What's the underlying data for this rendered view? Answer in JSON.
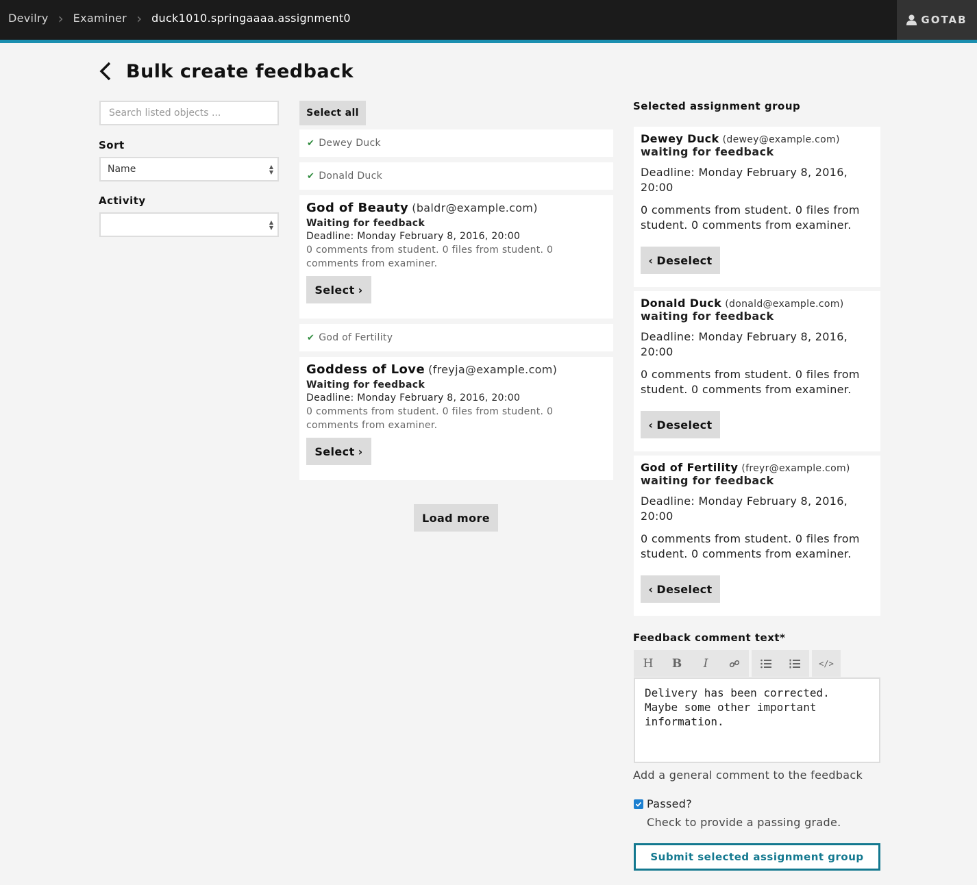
{
  "nav": {
    "breadcrumbs": [
      "Devilry",
      "Examiner",
      "duck1010.springaaaa.assignment0"
    ],
    "user": "GOTAB"
  },
  "page": {
    "title": "Bulk create feedback"
  },
  "filters": {
    "search_placeholder": "Search listed objects ...",
    "sort_label": "Sort",
    "sort_value": "Name",
    "activity_label": "Activity",
    "activity_value": ""
  },
  "list": {
    "select_all_label": "Select all",
    "load_more_label": "Load more",
    "select_label": "Select",
    "selected_items": [
      {
        "name": "Dewey Duck"
      },
      {
        "name": "Donald Duck"
      },
      {
        "name": "God of Fertility"
      }
    ],
    "cards": [
      {
        "name": "God of Beauty",
        "email": "(baldr@example.com)",
        "status": "Waiting for feedback",
        "deadline": "Deadline: Monday February 8, 2016, 20:00",
        "comments": "0 comments from student. 0 files from student. 0 comments from examiner."
      },
      {
        "name": "Goddess of Love",
        "email": "(freyja@example.com)",
        "status": "Waiting for feedback",
        "deadline": "Deadline: Monday February 8, 2016, 20:00",
        "comments": "0 comments from student. 0 files from student. 0 comments from examiner."
      }
    ]
  },
  "selected": {
    "heading": "Selected assignment group",
    "deselect_label": "Deselect",
    "groups": [
      {
        "name": "Dewey Duck",
        "email": "(dewey@example.com)",
        "status": "waiting for feedback",
        "deadline": "Deadline: Monday February 8, 2016, 20:00",
        "comments": "0 comments from student. 0 files from student. 0 comments from examiner."
      },
      {
        "name": "Donald Duck",
        "email": "(donald@example.com)",
        "status": "waiting for feedback",
        "deadline": "Deadline: Monday February 8, 2016, 20:00",
        "comments": "0 comments from student. 0 files from student. 0 comments from examiner."
      },
      {
        "name": "God of Fertility",
        "email": "(freyr@example.com)",
        "status": "waiting for feedback",
        "deadline": "Deadline: Monday February 8, 2016, 20:00",
        "comments": "0 comments from student. 0 files from student. 0 comments from examiner."
      }
    ]
  },
  "feedback": {
    "label": "Feedback comment text*",
    "toolbar": [
      "heading-icon",
      "bold-icon",
      "italic-icon",
      "link-icon",
      "bullet-list-icon",
      "numbered-list-icon",
      "code-icon"
    ],
    "text": "Delivery has been corrected.\nMaybe some other important\ninformation.",
    "help": "Add a general comment to the feedback",
    "passed_label": "Passed?",
    "passed_checked": true,
    "passed_help": "Check to provide a passing grade.",
    "submit_label": "Submit selected assignment group"
  },
  "colors": {
    "accent": "#1b8fb0",
    "submit": "#13788f",
    "check": "#2d8a3c",
    "topbar": "#1b1b1b"
  }
}
